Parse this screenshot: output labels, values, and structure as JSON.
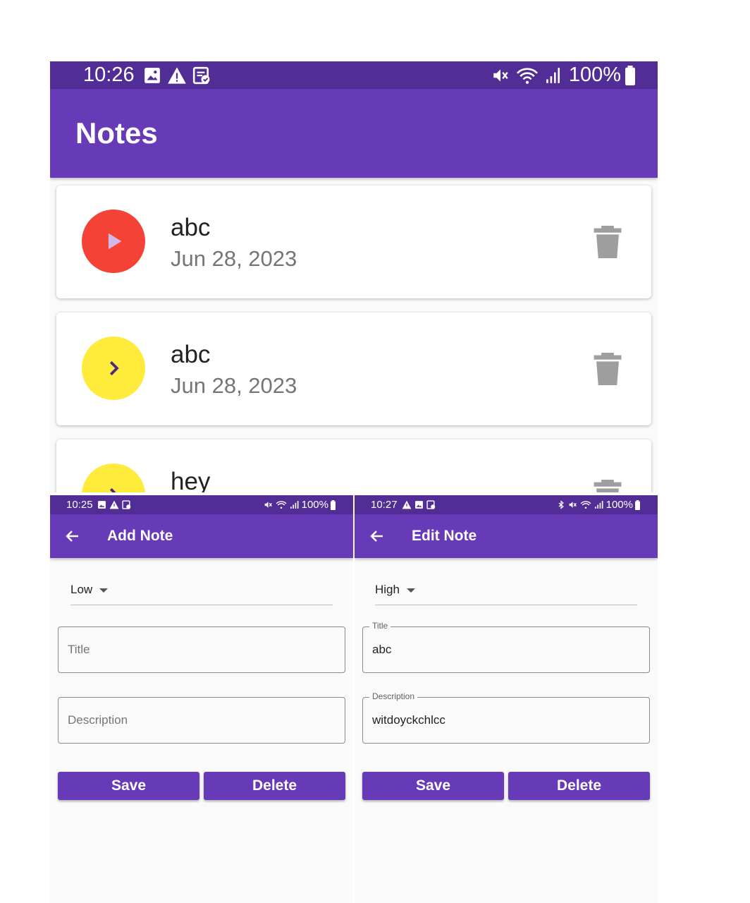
{
  "notes_screen": {
    "status_bar": {
      "time": "10:26",
      "battery": "100%"
    },
    "app_bar": {
      "title": "Notes"
    },
    "notes": [
      {
        "title": "abc",
        "date": "Jun 28, 2023",
        "priority_color": "#f44336",
        "icon": "play-arrow-icon"
      },
      {
        "title": "abc",
        "date": "Jun 28, 2023",
        "priority_color": "#ffeb3b",
        "icon": "chevron-right-icon"
      },
      {
        "title": "hey",
        "date": "",
        "priority_color": "#ffeb3b",
        "icon": "chevron-right-icon"
      }
    ]
  },
  "add_note_screen": {
    "status_bar": {
      "time": "10:25",
      "battery": "100%"
    },
    "app_bar": {
      "title": "Add Note"
    },
    "priority": {
      "value": "Low"
    },
    "title_field": {
      "placeholder": "Title",
      "value": ""
    },
    "description_field": {
      "placeholder": "Description",
      "value": ""
    },
    "buttons": {
      "save": "Save",
      "delete": "Delete"
    }
  },
  "edit_note_screen": {
    "status_bar": {
      "time": "10:27",
      "battery": "100%"
    },
    "app_bar": {
      "title": "Edit Note"
    },
    "priority": {
      "value": "High"
    },
    "title_field": {
      "label": "Title",
      "value": "abc"
    },
    "description_field": {
      "label": "Description",
      "value": "witdoyckchlcc"
    },
    "buttons": {
      "save": "Save",
      "delete": "Delete"
    }
  },
  "colors": {
    "status_bar": "#512d95",
    "app_bar": "#673ab7",
    "accent": "#673ab7",
    "high_priority": "#f44336",
    "low_priority": "#ffeb3b"
  }
}
